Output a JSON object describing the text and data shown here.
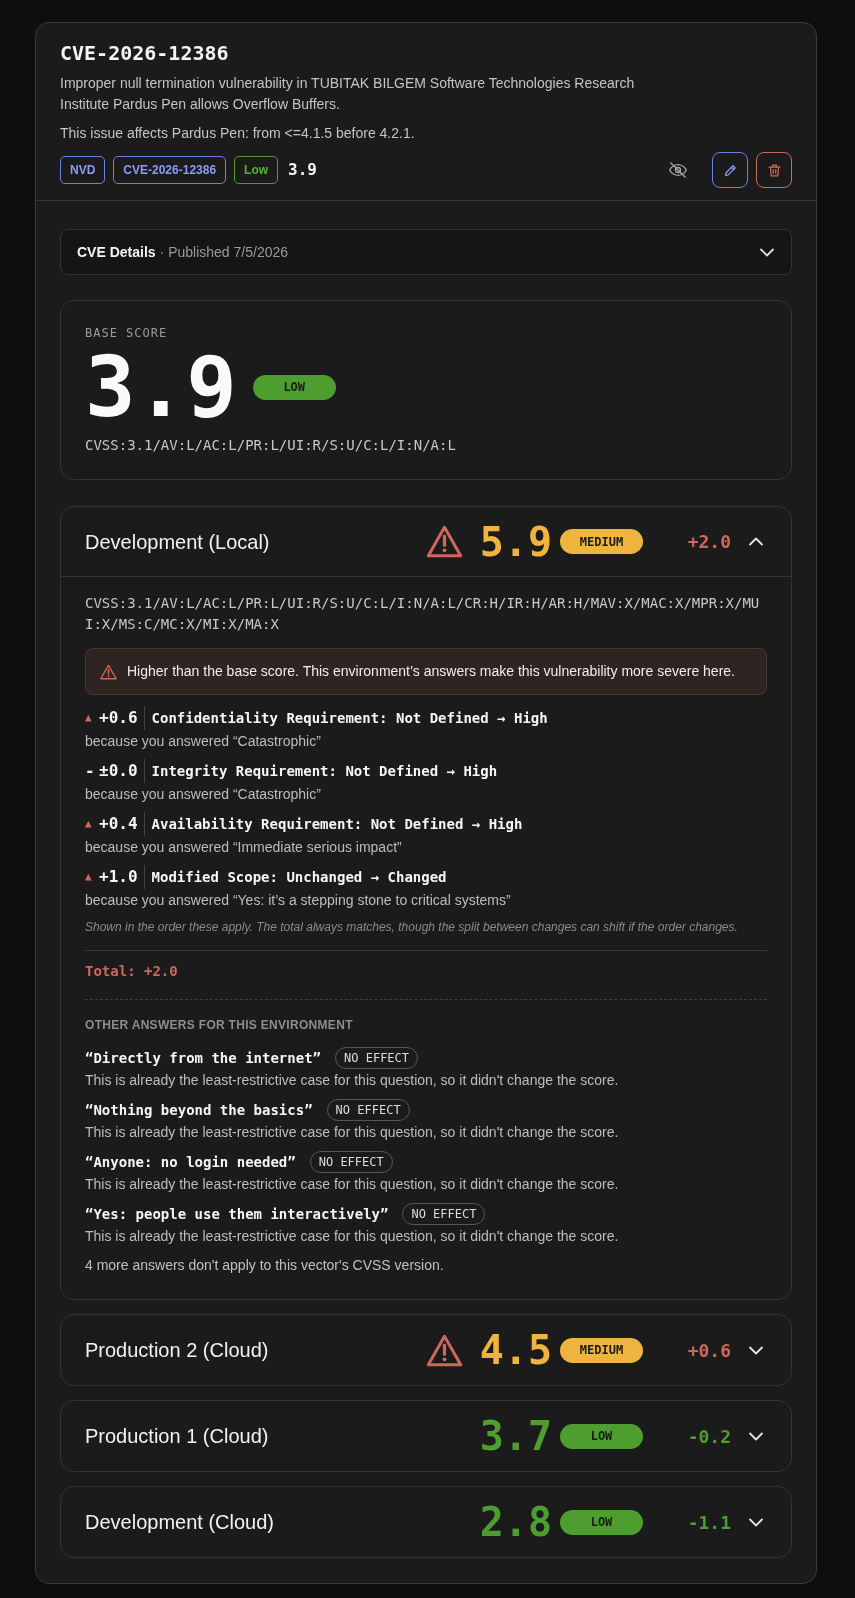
{
  "cve": {
    "id": "CVE-2026-12386",
    "description": "Improper null termination vulnerability in TUBITAK BILGEM Software Technologies Research Institute Pardus Pen allows Overflow Buffers.",
    "affects": "This issue affects Pardus Pen: from <=4.1.5 before 4.2.1.",
    "tags": [
      {
        "text": "NVD",
        "kind": "info"
      },
      {
        "text": "CVE-2026-12386",
        "kind": "info"
      },
      {
        "text": "Low",
        "kind": "low"
      }
    ],
    "score": "3.9"
  },
  "details": {
    "title": "CVE Details",
    "meta": "· Published 7/5/2026",
    "expanded": false
  },
  "base": {
    "label": "BASE SCORE",
    "score": "3.9",
    "severity": "LOW",
    "kind": "low",
    "vector": "CVSS:3.1/AV:L/AC:L/PR:L/UI:R/S:U/C:L/I:N/A:L"
  },
  "environments": [
    {
      "name": "Development (Local)",
      "expanded": true,
      "warning": true,
      "score": "5.9",
      "severity": "MEDIUM",
      "kind": "medium",
      "delta": "+2.0",
      "increase": true,
      "vector": "CVSS:3.1/AV:L/AC:L/PR:L/UI:R/S:U/C:L/I:N/A:L/CR:H/IR:H/AR:H/MAV:X/MAC:X/MPR:X/MUI:X/MS:C/MC:X/MI:X/MA:X",
      "alert": "Higher than the base score. This environment’s answers make this vulnerability more severe here.",
      "changes": [
        {
          "kind": "up",
          "marker": "▲",
          "delta": "+0.6",
          "change": "Confidentiality Requirement: Not Defined → High",
          "reason": "because you answered “Catastrophic”"
        },
        {
          "kind": "none",
          "marker": "-",
          "delta": "±0.0",
          "change": "Integrity Requirement: Not Defined → High",
          "reason": "because you answered “Catastrophic”"
        },
        {
          "kind": "up",
          "marker": "▲",
          "delta": "+0.4",
          "change": "Availability Requirement: Not Defined → High",
          "reason": "because you answered “Immediate serious impact”"
        },
        {
          "kind": "up",
          "marker": "▲",
          "delta": "+1.0",
          "change": "Modified Scope: Unchanged → Changed",
          "reason": "because you answered “Yes: it’s a stepping stone to critical systems”"
        }
      ],
      "note": "Shown in the order these apply. The total always matches, though the split between changes can shift if the order changes.",
      "total": "Total: +2.0",
      "other_heading": "OTHER ANSWERS FOR THIS ENVIRONMENT",
      "other_answers": [
        {
          "answer": "“Directly from the internet”",
          "effect": "NO EFFECT",
          "explanation": "This is already the least-restrictive case for this question, so it didn't change the score."
        },
        {
          "answer": "“Nothing beyond the basics”",
          "effect": "NO EFFECT",
          "explanation": "This is already the least-restrictive case for this question, so it didn't change the score."
        },
        {
          "answer": "“Anyone: no login needed”",
          "effect": "NO EFFECT",
          "explanation": "This is already the least-restrictive case for this question, so it didn't change the score."
        },
        {
          "answer": "“Yes: people use them interactively”",
          "effect": "NO EFFECT",
          "explanation": "This is already the least-restrictive case for this question, so it didn't change the score."
        }
      ],
      "footnote": "4 more answers don't apply to this vector's CVSS version."
    },
    {
      "name": "Production 2 (Cloud)",
      "expanded": false,
      "warning": true,
      "score": "4.5",
      "severity": "MEDIUM",
      "kind": "medium",
      "delta": "+0.6",
      "increase": true
    },
    {
      "name": "Production 1 (Cloud)",
      "expanded": false,
      "warning": false,
      "score": "3.7",
      "severity": "LOW",
      "kind": "low",
      "delta": "-0.2",
      "increase": false
    },
    {
      "name": "Development (Cloud)",
      "expanded": false,
      "warning": false,
      "score": "2.8",
      "severity": "LOW",
      "kind": "low",
      "delta": "-1.1",
      "increase": false
    }
  ]
}
